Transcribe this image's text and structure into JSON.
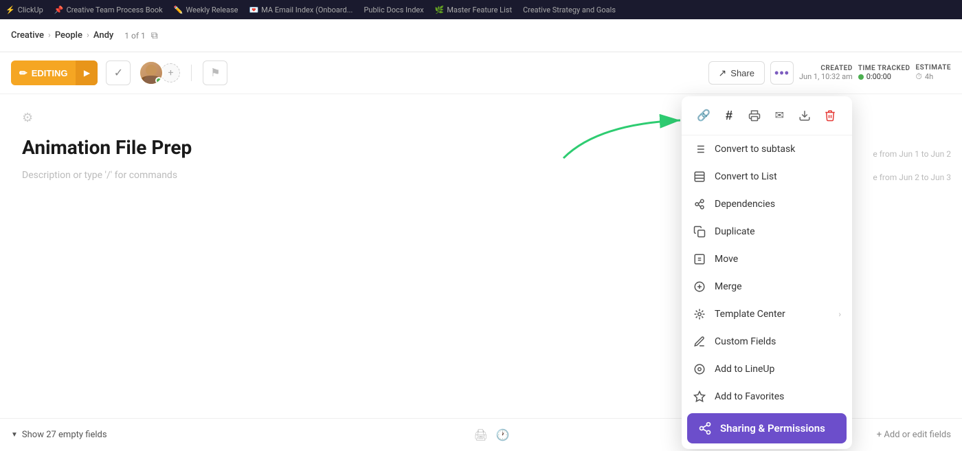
{
  "tabs": {
    "items": [
      {
        "label": "ClickUp",
        "icon": "",
        "active": false
      },
      {
        "label": "Creative Team Process Book",
        "icon": "📌",
        "active": false
      },
      {
        "label": "Weekly Release",
        "icon": "✏️",
        "active": false
      },
      {
        "label": "MA Email Index (Onboard...",
        "icon": "💌",
        "active": false
      },
      {
        "label": "Public Docs Index",
        "icon": "",
        "active": false
      },
      {
        "label": "Master Feature List",
        "icon": "🌿",
        "active": false
      },
      {
        "label": "Creative Strategy and Goals",
        "icon": "",
        "active": false
      }
    ]
  },
  "breadcrumb": {
    "parts": [
      "Creative",
      "People",
      "Andy"
    ],
    "count": "1 of 1"
  },
  "toolbar": {
    "editing_label": "EDITING",
    "check_icon": "✓",
    "share_label": "Share",
    "more_dots": "•••"
  },
  "meta": {
    "created_label": "CREATED",
    "created_value": "Jun 1, 10:32 am",
    "time_tracked_label": "TIME TRACKED",
    "time_tracked_value": "0:00:00",
    "estimate_label": "ESTIMATE",
    "estimate_value": "4h"
  },
  "document": {
    "title": "Animation File Prep",
    "description": "Description or type '/' for commands",
    "right_hint_1": "e from Jun 1 to Jun 2",
    "right_hint_2": "e from Jun 2 to Jun 3"
  },
  "bottom": {
    "show_fields_label": "Show 27 empty fields",
    "add_fields_label": "+ Add or edit fields"
  },
  "dropdown": {
    "icons": [
      {
        "name": "link-icon",
        "symbol": "🔗"
      },
      {
        "name": "hash-icon",
        "symbol": "#"
      },
      {
        "name": "print-icon",
        "symbol": "🖨"
      },
      {
        "name": "email-icon",
        "symbol": "✉"
      },
      {
        "name": "download-icon",
        "symbol": "⬇"
      },
      {
        "name": "trash-icon",
        "symbol": "🗑",
        "red": true
      }
    ],
    "items": [
      {
        "name": "convert-to-subtask",
        "label": "Convert to subtask",
        "icon": "⬆",
        "arrow": false
      },
      {
        "name": "convert-to-list",
        "label": "Convert to List",
        "icon": "☰",
        "arrow": false
      },
      {
        "name": "dependencies",
        "label": "Dependencies",
        "icon": "🔗",
        "arrow": false
      },
      {
        "name": "duplicate",
        "label": "Duplicate",
        "icon": "⧉",
        "arrow": false
      },
      {
        "name": "move",
        "label": "Move",
        "icon": "☐",
        "arrow": false
      },
      {
        "name": "merge",
        "label": "Merge",
        "icon": "⊕",
        "arrow": false
      },
      {
        "name": "template-center",
        "label": "Template Center",
        "icon": "✦",
        "arrow": true
      },
      {
        "name": "custom-fields",
        "label": "Custom Fields",
        "icon": "✏",
        "arrow": false
      },
      {
        "name": "add-to-lineup",
        "label": "Add to LineUp",
        "icon": "⊙",
        "arrow": false
      },
      {
        "name": "add-to-favorites",
        "label": "Add to Favorites",
        "icon": "☆",
        "arrow": false
      }
    ],
    "sharing_permissions": {
      "label": "Sharing & Permissions",
      "icon": "⇧"
    }
  }
}
